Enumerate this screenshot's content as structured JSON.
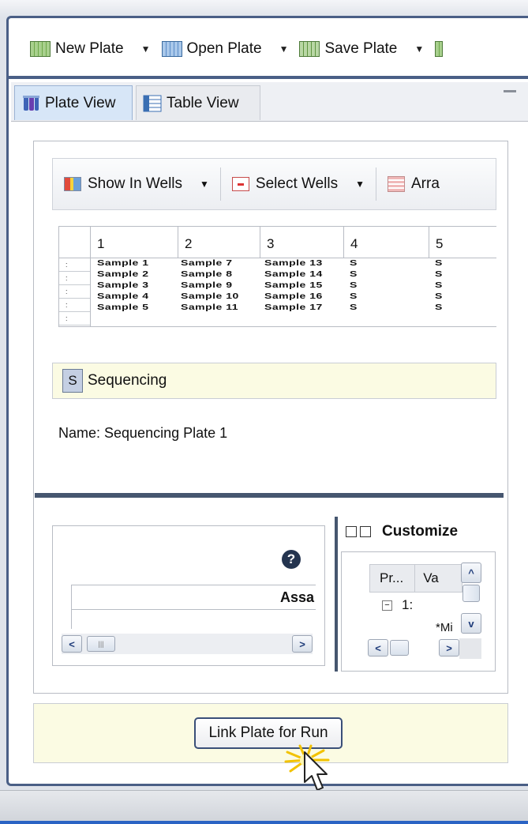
{
  "toolbar": {
    "new_plate": "New Plate",
    "open_plate": "Open Plate",
    "save_plate": "Save Plate"
  },
  "tabs": {
    "plate_view": "Plate View",
    "table_view": "Table View"
  },
  "subtoolbar": {
    "show_in_wells": "Show In Wells",
    "select_wells": "Select Wells",
    "arrange": "Arra"
  },
  "plate_grid": {
    "columns": [
      "",
      "1",
      "2",
      "3",
      "4",
      "5"
    ],
    "row_labels": [
      ":",
      ":",
      ":",
      ":",
      ":"
    ],
    "cells": [
      [
        "Sample 1",
        "Sample 7",
        "Sample 13",
        "S",
        "S"
      ],
      [
        "Sample 2",
        "Sample 8",
        "Sample 14",
        "S",
        "S"
      ],
      [
        "Sample 3",
        "Sample 9",
        "Sample 15",
        "S",
        "S"
      ],
      [
        "Sample 4",
        "Sample 10",
        "Sample 16",
        "S",
        "S"
      ],
      [
        "Sample 5",
        "Sample 11",
        "Sample 17",
        "S",
        "S"
      ]
    ]
  },
  "sequencing": {
    "badge": "S",
    "label": "Sequencing"
  },
  "plate_name": "Name: Sequencing Plate 1",
  "assay_panel": {
    "help": "?",
    "column_header": "Assa"
  },
  "customize_panel": {
    "title": "Customize",
    "prop_header": "Pr...",
    "value_header": "Va",
    "tree_item": "1:",
    "tree_value": "*Mi"
  },
  "footer": {
    "link_button": "Link Plate for Run"
  }
}
